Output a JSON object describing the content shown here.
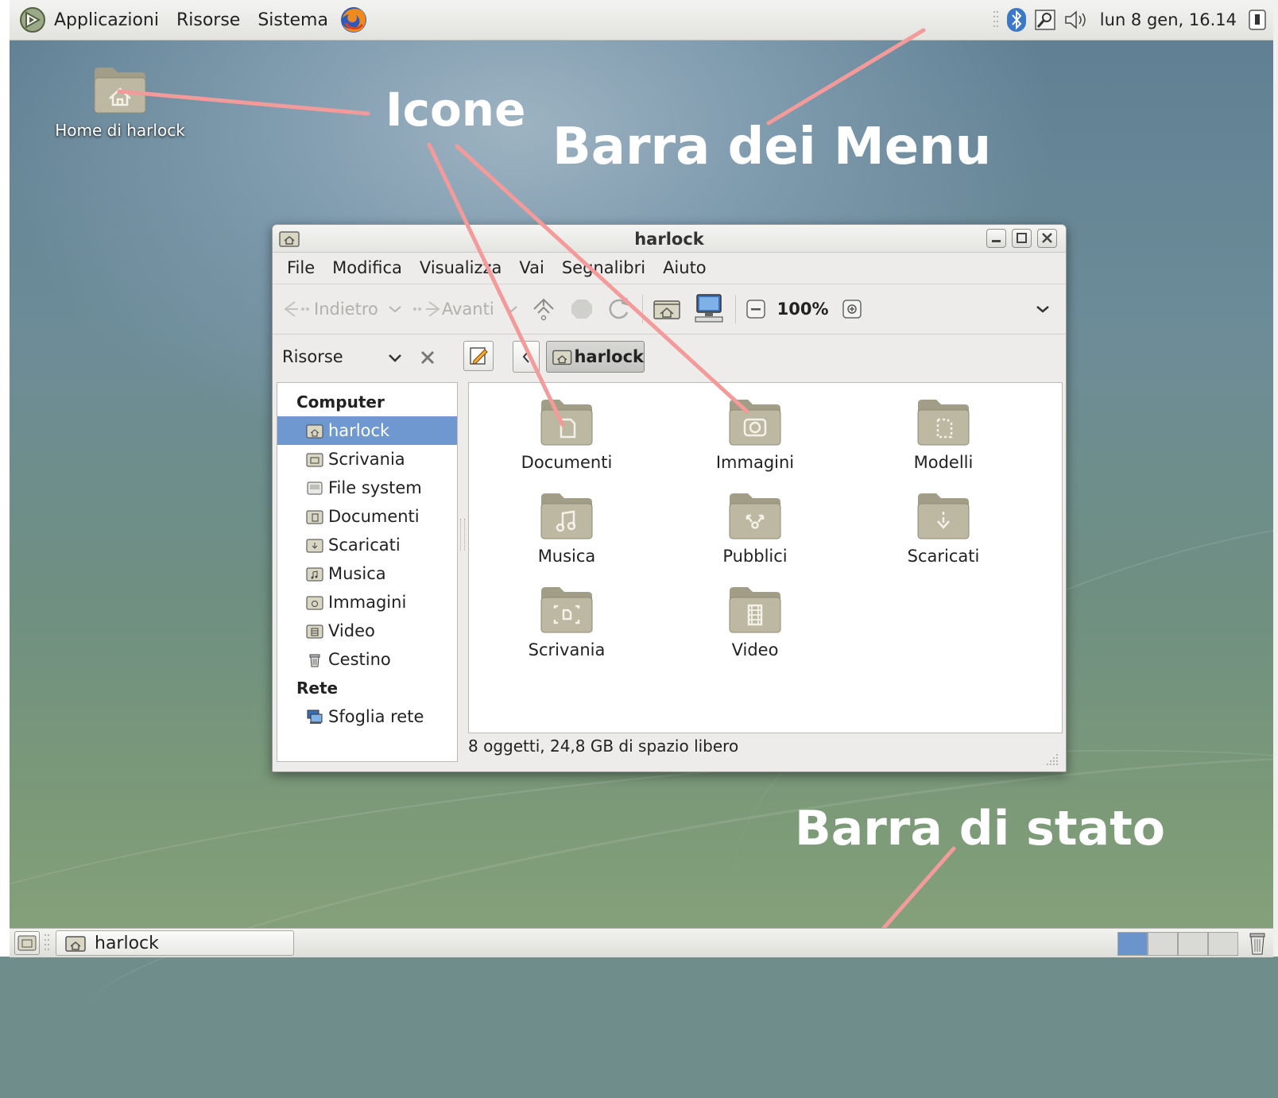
{
  "top_panel": {
    "menus": [
      "Applicazioni",
      "Risorse",
      "Sistema"
    ],
    "clock": "lun  8 gen, 16.14"
  },
  "desktop": {
    "home_icon_label": "Home di harlock"
  },
  "annotations": {
    "icons": "Icone",
    "menubar": "Barra dei Menu",
    "statusbar": "Barra di stato"
  },
  "window": {
    "title": "harlock",
    "menu": [
      "File",
      "Modifica",
      "Visualizza",
      "Vai",
      "Segnalibri",
      "Aiuto"
    ],
    "toolbar": {
      "back": "Indietro",
      "forward": "Avanti",
      "zoom": "100%"
    },
    "side_pane": {
      "selector": "Risorse",
      "sections": [
        {
          "header": "Computer",
          "items": [
            {
              "label": "harlock",
              "icon": "home-folder-icon",
              "selected": true
            },
            {
              "label": "Scrivania",
              "icon": "desktop-folder-icon",
              "selected": false
            },
            {
              "label": "File system",
              "icon": "drive-icon",
              "selected": false
            },
            {
              "label": "Documenti",
              "icon": "documents-folder-icon",
              "selected": false
            },
            {
              "label": "Scaricati",
              "icon": "downloads-folder-icon",
              "selected": false
            },
            {
              "label": "Musica",
              "icon": "music-folder-icon",
              "selected": false
            },
            {
              "label": "Immagini",
              "icon": "pictures-folder-icon",
              "selected": false
            },
            {
              "label": "Video",
              "icon": "videos-folder-icon",
              "selected": false
            },
            {
              "label": "Cestino",
              "icon": "trash-icon",
              "selected": false
            }
          ]
        },
        {
          "header": "Rete",
          "items": [
            {
              "label": "Sfoglia rete",
              "icon": "network-icon",
              "selected": false
            }
          ]
        }
      ]
    },
    "location": {
      "path_button": "harlock"
    },
    "folders": [
      {
        "label": "Documenti",
        "emblem": "document"
      },
      {
        "label": "Immagini",
        "emblem": "camera"
      },
      {
        "label": "Modelli",
        "emblem": "template"
      },
      {
        "label": "Musica",
        "emblem": "music"
      },
      {
        "label": "Pubblici",
        "emblem": "share"
      },
      {
        "label": "Scaricati",
        "emblem": "download"
      },
      {
        "label": "Scrivania",
        "emblem": "desktop"
      },
      {
        "label": "Video",
        "emblem": "film"
      }
    ],
    "status": "8 oggetti, 24,8 GB di spazio libero"
  },
  "bottom_panel": {
    "task_label": "harlock",
    "workspaces": 4,
    "active_workspace": 1
  },
  "colors": {
    "selection": "#6f97d0",
    "annotation_line": "#f39a9a",
    "folder": "#b7b39e"
  }
}
